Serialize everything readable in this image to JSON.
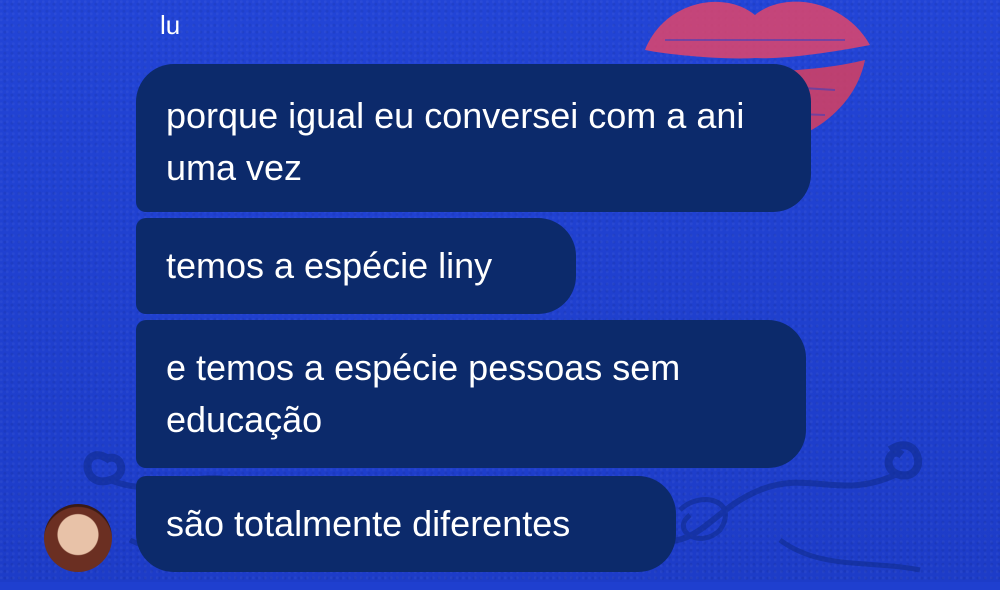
{
  "chat": {
    "sender_name": "lu",
    "messages": [
      {
        "text": "porque igual eu conversei com a ani uma vez"
      },
      {
        "text": "temos a espécie liny"
      },
      {
        "text": "e temos a espécie pessoas sem educação"
      },
      {
        "text": "são totalmente diferentes"
      }
    ]
  },
  "colors": {
    "background": "#1f3fcf",
    "bubble": "#0c2a6b",
    "text": "#ffffff",
    "lips_accent": "#e0456a"
  },
  "icons": {
    "avatar": "user-avatar",
    "decoration": "lipstick-kiss-icon"
  }
}
